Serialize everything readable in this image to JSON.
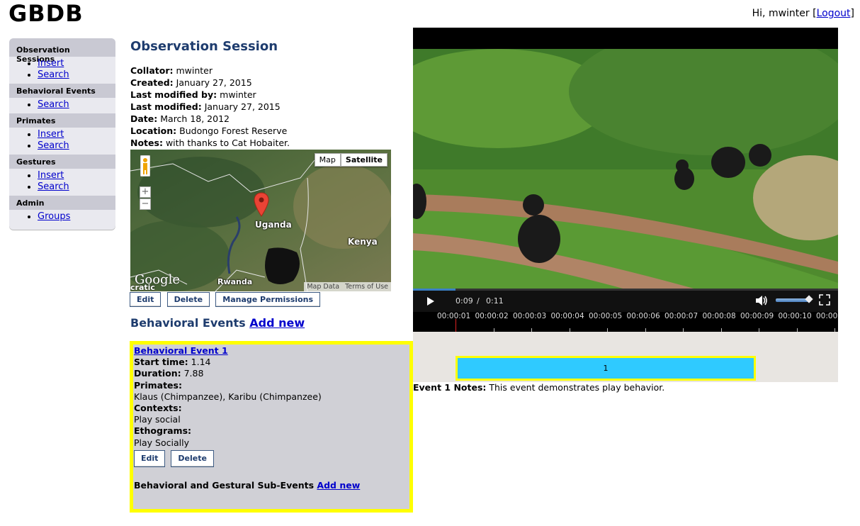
{
  "header": {
    "logo": "GBDB",
    "greeting": "Hi, mwinter [",
    "logout": "Logout",
    "close_bracket": "]"
  },
  "sidebar": {
    "sections": [
      {
        "title": "Observation Sessions",
        "links": [
          "Insert",
          "Search"
        ]
      },
      {
        "title": "Behavioral Events",
        "links": [
          "Search"
        ]
      },
      {
        "title": "Primates",
        "links": [
          "Insert",
          "Search"
        ]
      },
      {
        "title": "Gestures",
        "links": [
          "Insert",
          "Search"
        ]
      },
      {
        "title": "Admin",
        "links": [
          "Groups"
        ]
      }
    ]
  },
  "session": {
    "title": "Observation Session",
    "fields": [
      {
        "label": "Collator:",
        "value": "mwinter"
      },
      {
        "label": "Created:",
        "value": "January 27, 2015"
      },
      {
        "label": "Last modified by:",
        "value": "mwinter"
      },
      {
        "label": "Last modified:",
        "value": "January 27, 2015"
      },
      {
        "label": "Date:",
        "value": "March 18, 2012"
      },
      {
        "label": "Location:",
        "value": "Budongo Forest Reserve"
      },
      {
        "label": "Notes:",
        "value": "with thanks to Cat Hobaiter."
      }
    ],
    "buttons": {
      "edit": "Edit",
      "delete": "Delete",
      "permissions": "Manage Permissions"
    }
  },
  "map": {
    "type_map": "Map",
    "type_satellite": "Satellite",
    "zoom_in": "+",
    "zoom_out": "−",
    "labels": {
      "uganda": "Uganda",
      "kenya": "Kenya",
      "rwanda": "Rwanda",
      "cratic": "cratic"
    },
    "google": "Google",
    "footer": {
      "map_data": "Map Data",
      "terms": "Terms of Use"
    }
  },
  "behavioral_events": {
    "heading": "Behavioral Events",
    "add_new": "Add new"
  },
  "event": {
    "title": "Behavioral Event 1",
    "start_label": "Start time:",
    "start_value": "1.14",
    "duration_label": "Duration:",
    "duration_value": "7.88",
    "primates_label": "Primates:",
    "primates_value": "Klaus (Chimpanzee), Karibu (Chimpanzee)",
    "contexts_label": "Contexts:",
    "contexts_value": "Play social",
    "ethograms_label": "Ethograms:",
    "ethograms_value": "Play Socially",
    "edit": "Edit",
    "delete": "Delete",
    "sub_events_label": "Behavioral and Gestural Sub-Events",
    "sub_events_add": "Add new"
  },
  "video": {
    "current_time": "0:09",
    "separator": "/",
    "duration": "0:11",
    "progress": 0.1,
    "volume": 0.9,
    "timeline_ticks": [
      "00:00:01",
      "00:00:02",
      "00:00:03",
      "00:00:04",
      "00:00:05",
      "00:00:06",
      "00:00:07",
      "00:00:08",
      "00:00:09",
      "00:00:10",
      "00:00:"
    ],
    "event_block_label": "1"
  },
  "event_notes": {
    "label": "Event 1 Notes:",
    "text": "This event demonstrates play behavior."
  },
  "colors": {
    "heading_blue": "#1e3c6e",
    "highlight_yellow": "#ffff00",
    "event_block": "#2fcaff",
    "card_gray": "#d0d0d6"
  }
}
